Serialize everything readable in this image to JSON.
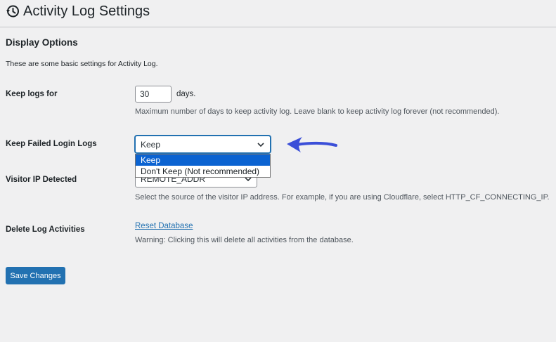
{
  "header": {
    "title": "Activity Log Settings",
    "icon": "history-icon"
  },
  "section": {
    "title": "Display Options",
    "description": "These are some basic settings for Activity Log."
  },
  "fields": {
    "keep_logs": {
      "label": "Keep logs for",
      "value": "30",
      "suffix": "days.",
      "help": "Maximum number of days to keep activity log. Leave blank to keep activity log forever (not recommended)."
    },
    "keep_failed_login": {
      "label": "Keep Failed Login Logs",
      "selected": "Keep",
      "options": [
        "Keep",
        "Don't Keep (Not recommended)"
      ],
      "dropdown_open": true
    },
    "visitor_ip": {
      "label": "Visitor IP Detected",
      "selected": "REMOTE_ADDR",
      "help": "Select the source of the visitor IP address. For example, if you are using Cloudflare, select HTTP_CF_CONNECTING_IP."
    },
    "delete_logs": {
      "label": "Delete Log Activities",
      "link": "Reset Database",
      "warning": "Warning: Clicking this will delete all activities from the database."
    }
  },
  "actions": {
    "save_label": "Save Changes"
  },
  "colors": {
    "accent": "#2271b1",
    "annotation_arrow": "#3b4fd8",
    "selected_option": "#0b63d1"
  }
}
